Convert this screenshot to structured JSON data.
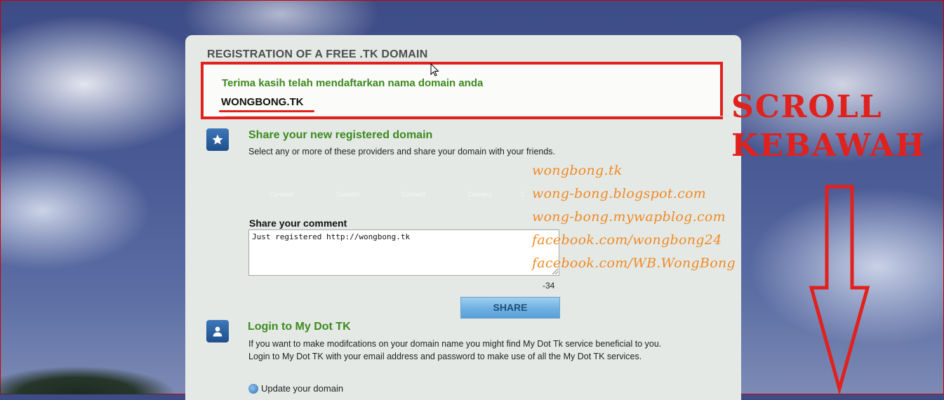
{
  "panel": {
    "title": "REGISTRATION OF A FREE .TK DOMAIN",
    "thanks": "Terima kasih telah mendaftarkan nama domain anda",
    "domain": "WONGBONG.TK"
  },
  "share": {
    "heading": "Share your new registered domain",
    "description": "Select any or more of these providers and share your domain with your friends.",
    "connect_labels": [
      "Connect",
      "Connect",
      "Connect",
      "Connect",
      "C"
    ],
    "comment_label": "Share your comment",
    "comment_value": "Just registered http://wongbong.tk",
    "char_count": "-34",
    "button_label": "SHARE"
  },
  "login": {
    "heading": "Login to My Dot TK",
    "description": "If you want to make modifcations on your domain name you might find My Dot Tk service beneficial to you. Login to My Dot TK with your email address and password to make use of all the My Dot TK services.",
    "update_link": "Update your domain"
  },
  "watermark": {
    "lines": [
      "wongbong.tk",
      "wong-bong.blogspot.com",
      "wong-bong.mywapblog.com",
      "facebook.com/wongbong24",
      "facebook.com/WB.WongBong"
    ]
  },
  "annotation": {
    "line1": "SCROLL",
    "line2": "KEBAWAH"
  },
  "colors": {
    "accent_green": "#3c8a1e",
    "annotation_red": "#e0211d",
    "watermark_orange": "#f08a24"
  }
}
